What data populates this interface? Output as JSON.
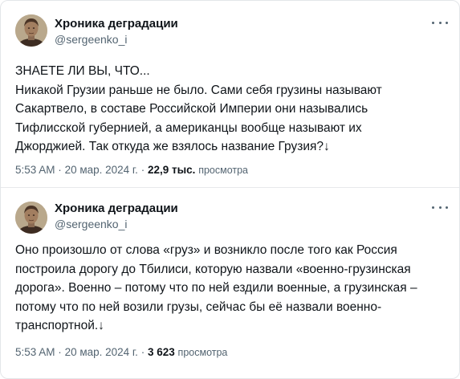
{
  "tweets": [
    {
      "author_name": "Хроника деградации",
      "author_handle": "@sergeenko_i",
      "lines": [
        "ЗНАЕТЕ ЛИ ВЫ, ЧТО...",
        "Никакой Грузии раньше не было. Сами себя грузины называют",
        "Сакартвело, в составе Российской Империи они назывались",
        "Тифлисской губернией, а американцы вообще называют их",
        "Джорджией. Так откуда же взялось название Грузия?↓"
      ],
      "time": "5:53 AM",
      "separator": "·",
      "date": "20 мар. 2024 г.",
      "views_count": "22,9 тыс.",
      "views_label": "просмотра"
    },
    {
      "author_name": "Хроника деградации",
      "author_handle": "@sergeenko_i",
      "lines": [
        "Оно произошло от слова «груз» и возникло после того как Россия",
        "построила дорогу до Тбилиси, которую назвали «военно-грузинская",
        "дорога». Военно – потому что по ней ездили военные, а грузинская –",
        "потому что по ней возили грузы, сейчас бы её назвали военно-",
        "транспортной.↓"
      ],
      "time": "5:53 AM",
      "separator": "·",
      "date": "20 мар. 2024 г.",
      "views_count": "3 623",
      "views_label": "просмотра"
    }
  ],
  "icons": {
    "avatar": "avatar-portrait",
    "more": "more-horizontal-icon"
  },
  "colors": {
    "text_primary": "#0f1419",
    "text_secondary": "#536471",
    "border": "#e7e9eb"
  }
}
